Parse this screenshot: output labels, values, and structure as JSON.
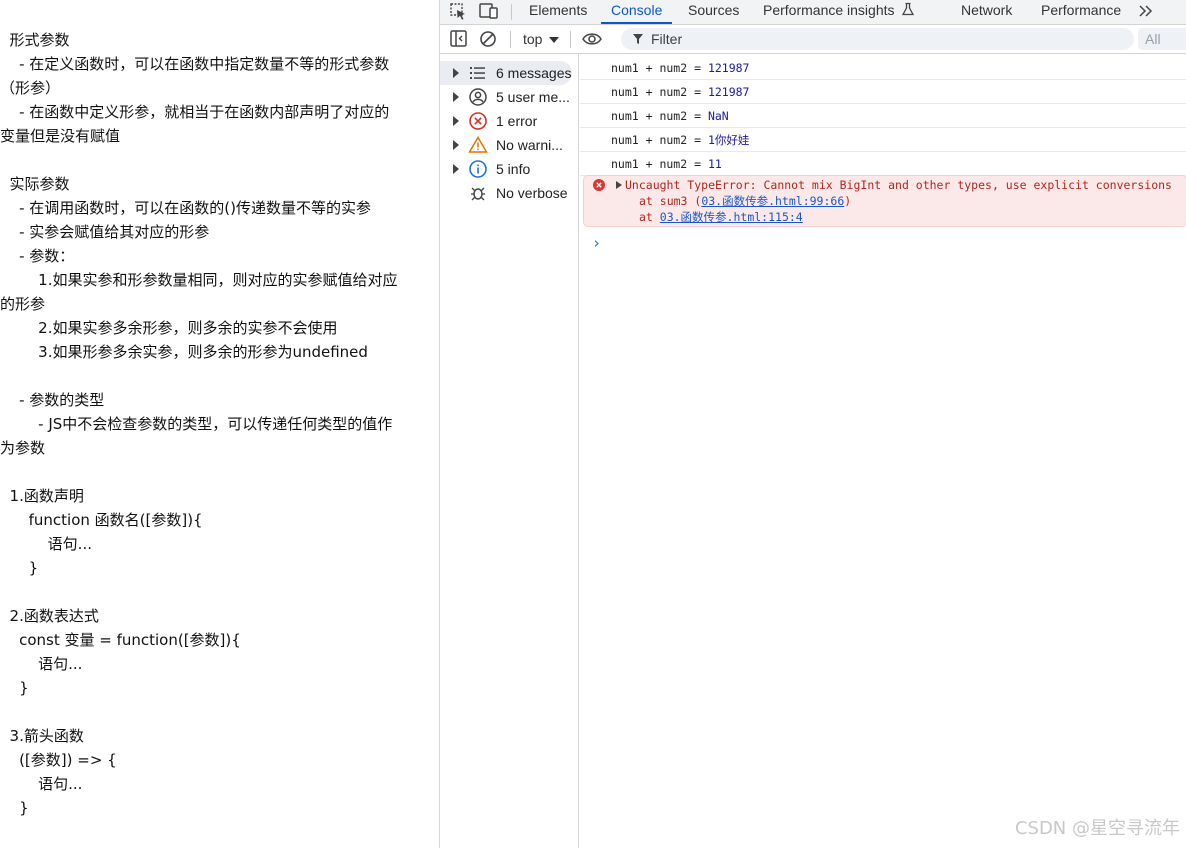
{
  "notes": {
    "lines": [
      "  形式参数",
      "    - 在定义函数时，可以在函数中指定数量不等的形式参数",
      "（形参）",
      "    - 在函数中定义形参，就相当于在函数内部声明了对应的",
      "变量但是没有赋值",
      "",
      "  实际参数",
      "    - 在调用函数时，可以在函数的()传递数量不等的实参",
      "    - 实参会赋值给其对应的形参",
      "    - 参数：",
      "        1.如果实参和形参数量相同，则对应的实参赋值给对应",
      "的形参",
      "        2.如果实参多余形参，则多余的实参不会使用",
      "        3.如果形参多余实参，则多余的形参为undefined",
      "",
      "    - 参数的类型",
      "        - JS中不会检查参数的类型，可以传递任何类型的值作",
      "为参数",
      "",
      "  1.函数声明",
      "      function 函数名([参数]){",
      "          语句...",
      "      }",
      "",
      "  2.函数表达式",
      "    const 变量 = function([参数]){",
      "        语句...",
      "    }",
      "",
      "  3.箭头函数",
      "    ([参数]) => {",
      "        语句...",
      "    }"
    ]
  },
  "devtools": {
    "tabs": {
      "elements": "Elements",
      "console": "Console",
      "sources": "Sources",
      "perf_insights": "Performance insights",
      "network": "Network",
      "performance": "Performance"
    },
    "toolbar": {
      "context": "top",
      "filter_placeholder": "Filter",
      "levels": "All levels"
    },
    "sidebar": {
      "items": [
        {
          "label": "6 messages",
          "icon": "list-icon"
        },
        {
          "label": "5 user me...",
          "icon": "user-icon"
        },
        {
          "label": "1 error",
          "icon": "error-icon"
        },
        {
          "label": "No warni...",
          "icon": "warning-icon"
        },
        {
          "label": "5 info",
          "icon": "info-icon"
        },
        {
          "label": "No verbose",
          "icon": "bug-icon"
        }
      ]
    },
    "console": {
      "messages": [
        {
          "text": "num1 + num2 = ",
          "value": "121987"
        },
        {
          "text": "num1 + num2 = ",
          "value": "121987"
        },
        {
          "text": "num1 + num2 = ",
          "value": "NaN"
        },
        {
          "text": "num1 + num2 = ",
          "value": "1你好娃"
        },
        {
          "text": "num1 + num2 = ",
          "value": "11"
        }
      ],
      "error": {
        "message": "Uncaught TypeError: Cannot mix BigInt and other types, use explicit conversions",
        "stack1_prefix": "at sum3 (",
        "stack1_link": "03.函数传参.html:99:66",
        "stack1_suffix": ")",
        "stack2_prefix": "at ",
        "stack2_link": "03.函数传参.html:115:4"
      },
      "prompt": "›"
    }
  },
  "watermark": "CSDN @星空寻流年",
  "colors": {
    "accent": "#0b57d0",
    "error_bg": "#fbe9e9",
    "error_text": "#b3261e",
    "value_blue": "#1a1aa6"
  }
}
